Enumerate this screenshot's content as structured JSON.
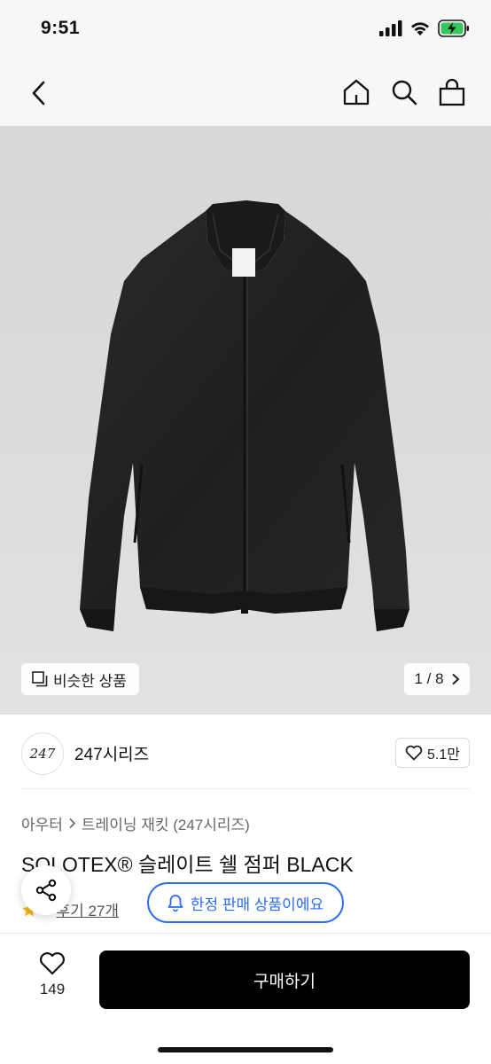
{
  "status_bar": {
    "time": "9:51"
  },
  "gallery": {
    "similar_label": "비슷한 상품",
    "counter": "1 / 8"
  },
  "brand": {
    "logo_text": "247",
    "name": "247시리즈",
    "like_count": "5.1만"
  },
  "breadcrumb": {
    "category": "아우터",
    "subcategory": "트레이닝 재킷 (247시리즈)"
  },
  "product": {
    "title": "SOLOTEX® 슬레이트 쉘 점퍼 BLACK",
    "rating": "5",
    "review_link": "후기 27개",
    "limited_label": "한정 판매 상품이에요"
  },
  "bottom_bar": {
    "wish_count": "149",
    "buy_label": "구매하기"
  },
  "colors": {
    "accent": "#2b6cf6",
    "star": "#f6b51e",
    "battery": "#35c759",
    "buy_button": "#000000"
  }
}
